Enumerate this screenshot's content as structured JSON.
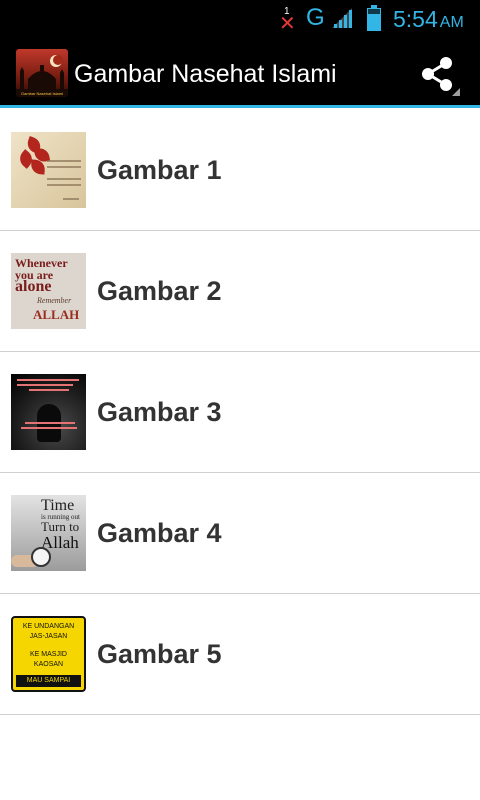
{
  "status_bar": {
    "notification_count": "1",
    "notification_icon": "x-icon",
    "network_type": "G",
    "signal_icon": "signal-icon",
    "battery_icon": "battery-icon",
    "time": "5:54",
    "ampm": "AM",
    "accent_color": "#33b5e5"
  },
  "action_bar": {
    "app_icon_caption": "Gambar Nasehat Islami",
    "title": "Gambar Nasehat Islami",
    "share_icon": "share-icon",
    "accent_color": "#33b5e5"
  },
  "list": {
    "items": [
      {
        "label": "Gambar 1"
      },
      {
        "label": "Gambar 2",
        "thumb_text": [
          "Whenever",
          "you are",
          "alone",
          "Remember",
          "ALLAH"
        ]
      },
      {
        "label": "Gambar 3"
      },
      {
        "label": "Gambar 4",
        "thumb_text": [
          "Time",
          "is running out",
          "Turn to",
          "Allah"
        ]
      },
      {
        "label": "Gambar 5",
        "thumb_text": [
          "KE UNDANGAN",
          "JAS-JASAN",
          "KE MASJID",
          "KAOSAN",
          "MAU SAMPAI KAPAN ?"
        ]
      }
    ]
  }
}
